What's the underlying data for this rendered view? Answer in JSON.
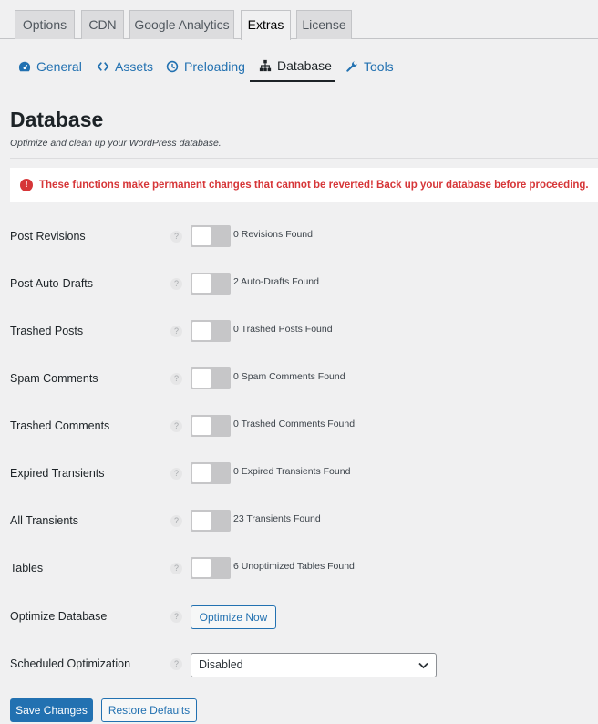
{
  "nav": {
    "tabs": [
      {
        "label": "Options",
        "active": false
      },
      {
        "label": "CDN",
        "active": false
      },
      {
        "label": "Google Analytics",
        "active": false
      },
      {
        "label": "Extras",
        "active": true
      },
      {
        "label": "License",
        "active": false
      }
    ]
  },
  "subnav": {
    "items": [
      {
        "label": "General",
        "icon": "dashboard-icon"
      },
      {
        "label": "Assets",
        "icon": "code-icon"
      },
      {
        "label": "Preloading",
        "icon": "clock-icon"
      },
      {
        "label": "Database",
        "icon": "sitemap-icon",
        "active": true
      },
      {
        "label": "Tools",
        "icon": "wrench-icon"
      }
    ]
  },
  "page": {
    "title": "Database",
    "description": "Optimize and clean up your WordPress database."
  },
  "notice": {
    "icon": "!",
    "text": "These functions make permanent changes that cannot be reverted! Back up your database before proceeding.",
    "color": "#d63638"
  },
  "help_glyph": "?",
  "rows": [
    {
      "label": "Post Revisions",
      "count": "0 Revisions Found",
      "enabled": false
    },
    {
      "label": "Post Auto-Drafts",
      "count": "2 Auto-Drafts Found",
      "enabled": false
    },
    {
      "label": "Trashed Posts",
      "count": "0 Trashed Posts Found",
      "enabled": false
    },
    {
      "label": "Spam Comments",
      "count": "0 Spam Comments Found",
      "enabled": false
    },
    {
      "label": "Trashed Comments",
      "count": "0 Trashed Comments Found",
      "enabled": false
    },
    {
      "label": "Expired Transients",
      "count": "0 Expired Transients Found",
      "enabled": false
    },
    {
      "label": "All Transients",
      "count": "23 Transients Found",
      "enabled": false
    },
    {
      "label": "Tables",
      "count": "6 Unoptimized Tables Found",
      "enabled": false
    }
  ],
  "optimize": {
    "label": "Optimize Database",
    "button": "Optimize Now"
  },
  "scheduled": {
    "label": "Scheduled Optimization",
    "selected": "Disabled"
  },
  "footer": {
    "save": "Save Changes",
    "restore": "Restore Defaults"
  },
  "colors": {
    "accent": "#2271b1",
    "danger": "#d63638",
    "toggle_off": "#c6c6c8"
  }
}
